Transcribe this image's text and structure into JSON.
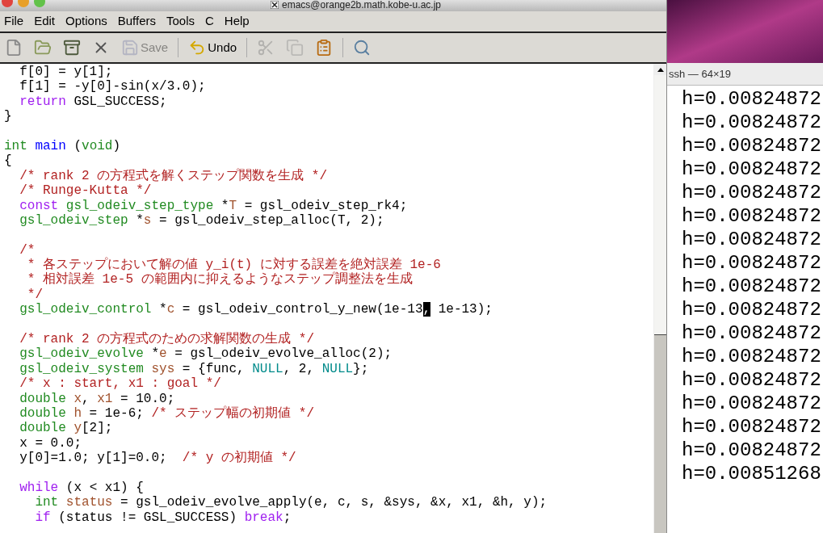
{
  "window": {
    "title": "emacs@orange2b.math.kobe-u.ac.jp"
  },
  "menu": [
    "File",
    "Edit",
    "Options",
    "Buffers",
    "Tools",
    "C",
    "Help"
  ],
  "toolbar": [
    {
      "disabled": false,
      "separator_after": false
    },
    {
      "disabled": false,
      "separator_after": false
    },
    {
      "disabled": false,
      "separator_after": false
    },
    {
      "disabled": false,
      "separator_after": false
    },
    {
      "label": "Save",
      "disabled": true,
      "separator_after": true
    },
    {
      "label": "Undo",
      "disabled": false,
      "separator_after": true
    },
    {
      "disabled": true,
      "separator_after": false
    },
    {
      "disabled": true,
      "separator_after": false
    },
    {
      "disabled": false,
      "separator_after": true
    },
    {
      "disabled": false,
      "separator_after": false
    }
  ],
  "code_lines": [
    {
      "kind": "code",
      "tokens": [
        {
          "kind": "plain",
          "text": "  f[0] = y[1];"
        }
      ]
    },
    {
      "kind": "code",
      "tokens": [
        {
          "kind": "plain",
          "text": "  f[1] = -y[0]-sin(x/3.0);"
        }
      ]
    },
    {
      "kind": "code",
      "tokens": [
        {
          "kind": "keyword",
          "text": "  return"
        },
        {
          "kind": "plain",
          "text": " GSL_SUCCESS;"
        }
      ]
    },
    {
      "kind": "code",
      "tokens": [
        {
          "kind": "plain",
          "text": "}"
        }
      ]
    },
    {
      "kind": "blank"
    },
    {
      "kind": "code",
      "tokens": [
        {
          "kind": "type",
          "text": "int"
        },
        {
          "kind": "function",
          "text": " main"
        },
        {
          "kind": "plain",
          "text": " ("
        },
        {
          "kind": "type",
          "text": "void"
        },
        {
          "kind": "plain",
          "text": ")"
        }
      ]
    },
    {
      "kind": "code",
      "tokens": [
        {
          "kind": "plain",
          "text": "{"
        }
      ]
    },
    {
      "kind": "code",
      "tokens": [
        {
          "kind": "comment",
          "text": "  /* rank 2 の方程式を解くステップ関数を生成 */"
        }
      ]
    },
    {
      "kind": "code",
      "tokens": [
        {
          "kind": "comment",
          "text": "  /* Runge-Kutta */"
        }
      ]
    },
    {
      "kind": "code",
      "tokens": [
        {
          "kind": "keyword",
          "text": "  const"
        },
        {
          "kind": "type",
          "text": " gsl_odeiv_step_type"
        },
        {
          "kind": "plain",
          "text": " *"
        },
        {
          "kind": "variable",
          "text": "T"
        },
        {
          "kind": "plain",
          "text": " = gsl_odeiv_step_rk4;"
        }
      ]
    },
    {
      "kind": "code",
      "tokens": [
        {
          "kind": "type",
          "text": "  gsl_odeiv_step"
        },
        {
          "kind": "plain",
          "text": " *"
        },
        {
          "kind": "variable",
          "text": "s"
        },
        {
          "kind": "plain",
          "text": " = gsl_odeiv_step_alloc(T, 2);"
        }
      ]
    },
    {
      "kind": "blank"
    },
    {
      "kind": "code",
      "tokens": [
        {
          "kind": "comment",
          "text": "  /*"
        }
      ]
    },
    {
      "kind": "code",
      "tokens": [
        {
          "kind": "comment",
          "text": "   * 各ステップにおいて解の値 y_i(t) に対する誤差を絶対誤差 1e-6"
        }
      ]
    },
    {
      "kind": "code",
      "tokens": [
        {
          "kind": "comment",
          "text": "   * 相対誤差 1e-5 の範囲内に抑えるようなステップ調整法を生成"
        }
      ]
    },
    {
      "kind": "code",
      "tokens": [
        {
          "kind": "comment",
          "text": "   */"
        }
      ]
    },
    {
      "kind": "code",
      "tokens": [
        {
          "kind": "type",
          "text": "  gsl_odeiv_control"
        },
        {
          "kind": "plain",
          "text": " *"
        },
        {
          "kind": "variable",
          "text": "c"
        },
        {
          "kind": "plain",
          "text": " = gsl_odeiv_control_y_new(1e-13"
        },
        {
          "kind": "cursor",
          "text": ","
        },
        {
          "kind": "plain",
          "text": " 1e-13);"
        }
      ]
    },
    {
      "kind": "blank"
    },
    {
      "kind": "code",
      "tokens": [
        {
          "kind": "comment",
          "text": "  /* rank 2 の方程式のための求解関数の生成 */"
        }
      ]
    },
    {
      "kind": "code",
      "tokens": [
        {
          "kind": "type",
          "text": "  gsl_odeiv_evolve"
        },
        {
          "kind": "plain",
          "text": " *"
        },
        {
          "kind": "variable",
          "text": "e"
        },
        {
          "kind": "plain",
          "text": " = gsl_odeiv_evolve_alloc(2);"
        }
      ]
    },
    {
      "kind": "code",
      "tokens": [
        {
          "kind": "type",
          "text": "  gsl_odeiv_system"
        },
        {
          "kind": "variable",
          "text": " sys"
        },
        {
          "kind": "plain",
          "text": " = {func, "
        },
        {
          "kind": "constant",
          "text": "NULL"
        },
        {
          "kind": "plain",
          "text": ", 2, "
        },
        {
          "kind": "constant",
          "text": "NULL"
        },
        {
          "kind": "plain",
          "text": "};"
        }
      ]
    },
    {
      "kind": "code",
      "tokens": [
        {
          "kind": "comment",
          "text": "  /* x : start, x1 : goal */"
        }
      ]
    },
    {
      "kind": "code",
      "tokens": [
        {
          "kind": "type",
          "text": "  double"
        },
        {
          "kind": "variable",
          "text": " x"
        },
        {
          "kind": "plain",
          "text": ", "
        },
        {
          "kind": "variable",
          "text": "x1"
        },
        {
          "kind": "plain",
          "text": " = 10.0;"
        }
      ]
    },
    {
      "kind": "code",
      "tokens": [
        {
          "kind": "type",
          "text": "  double"
        },
        {
          "kind": "variable",
          "text": " h"
        },
        {
          "kind": "plain",
          "text": " = 1e-6; "
        },
        {
          "kind": "comment",
          "text": "/* ステップ幅の初期値 */"
        }
      ]
    },
    {
      "kind": "code",
      "tokens": [
        {
          "kind": "type",
          "text": "  double"
        },
        {
          "kind": "variable",
          "text": " y"
        },
        {
          "kind": "plain",
          "text": "[2];"
        }
      ]
    },
    {
      "kind": "code",
      "tokens": [
        {
          "kind": "plain",
          "text": "  x = 0.0;"
        }
      ]
    },
    {
      "kind": "code",
      "tokens": [
        {
          "kind": "plain",
          "text": "  y[0]=1.0; y[1]=0.0;  "
        },
        {
          "kind": "comment",
          "text": "/* y の初期値 */"
        }
      ]
    },
    {
      "kind": "blank"
    },
    {
      "kind": "code",
      "tokens": [
        {
          "kind": "keyword",
          "text": "  while"
        },
        {
          "kind": "plain",
          "text": " (x < x1) {"
        }
      ]
    },
    {
      "kind": "code",
      "tokens": [
        {
          "kind": "type",
          "text": "    int"
        },
        {
          "kind": "variable",
          "text": " status"
        },
        {
          "kind": "plain",
          "text": " = gsl_odeiv_evolve_apply(e, c, s, &sys, &x, x1, &h, y);"
        }
      ]
    },
    {
      "kind": "code",
      "tokens": [
        {
          "kind": "keyword",
          "text": "    if"
        },
        {
          "kind": "plain",
          "text": " (status != GSL_SUCCESS) "
        },
        {
          "kind": "keyword",
          "text": "break"
        },
        {
          "kind": "plain",
          "text": ";"
        }
      ]
    }
  ],
  "terminal": {
    "title": "ssh — 64×19",
    "lines": [
      "h=0.00824872",
      "h=0.00824872",
      "h=0.00824872",
      "h=0.00824872",
      "h=0.00824872",
      "h=0.00824872",
      "h=0.00824872",
      "h=0.00824872",
      "h=0.00824872",
      "h=0.00824872",
      "h=0.00824872",
      "h=0.00824872",
      "h=0.00824872",
      "h=0.00824872",
      "h=0.00824872",
      "h=0.00824872",
      "h=0.00851268"
    ]
  }
}
